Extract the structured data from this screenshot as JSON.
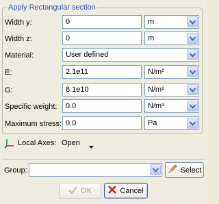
{
  "section": {
    "title": "Apply Rectangular section",
    "fields": [
      {
        "key": "width_y",
        "label": "Width y:",
        "value": "0",
        "unit": "m"
      },
      {
        "key": "width_z",
        "label": "Width z:",
        "value": "0",
        "unit": "m"
      }
    ],
    "material": {
      "label": "Material:",
      "value": "User defined"
    },
    "props": [
      {
        "key": "E",
        "label": "E:",
        "value": "2.1e11",
        "unit": "N/m²"
      },
      {
        "key": "G",
        "label": "G:",
        "value": "8.1e10",
        "unit": "N/m²"
      },
      {
        "key": "specific_weight",
        "label": "Specific weight:",
        "value": "0.0",
        "unit": "N/m³"
      },
      {
        "key": "max_stress",
        "label": "Maximum stress:",
        "value": "0.0",
        "unit": "Pa"
      }
    ]
  },
  "local_axes": {
    "label": "Local Axes:",
    "state": "Open"
  },
  "group": {
    "label": "Group:",
    "value": "",
    "select_label": "Select"
  },
  "actions": {
    "ok_label": "OK",
    "cancel_label": "Cancel"
  },
  "icons": {
    "combo_arrow": "chevron-down-icon",
    "axes": "axes-icon",
    "select": "pencil-icon",
    "ok": "checkmark-icon",
    "cancel": "x-mark-icon"
  },
  "colors": {
    "title": "#2a54c4",
    "cancel_x": "#d41a1a",
    "ok_check": "#b7c4a8"
  }
}
